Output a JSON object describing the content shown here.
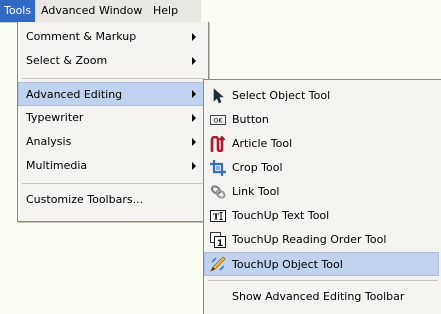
{
  "menubar": {
    "items": [
      {
        "label": "Tools",
        "active": true
      },
      {
        "label": "Advanced"
      },
      {
        "label": "Window"
      },
      {
        "label": "Help"
      }
    ]
  },
  "tools_menu": {
    "items": [
      {
        "label": "Comment & Markup",
        "has_submenu": true
      },
      {
        "label": "Select & Zoom",
        "has_submenu": true
      },
      {
        "label": "Advanced Editing",
        "has_submenu": true,
        "highlighted": true
      },
      {
        "label": "Typewriter",
        "has_submenu": true
      },
      {
        "label": "Analysis",
        "has_submenu": true
      },
      {
        "label": "Multimedia",
        "has_submenu": true
      },
      {
        "label": "Customize Toolbars..."
      }
    ]
  },
  "advanced_editing_menu": {
    "items": [
      {
        "label": "Select Object Tool",
        "icon": "select-object-arrow-icon"
      },
      {
        "label": "Button",
        "icon": "ok-button-icon"
      },
      {
        "label": "Article Tool",
        "icon": "article-icon"
      },
      {
        "label": "Crop Tool",
        "icon": "crop-icon"
      },
      {
        "label": "Link Tool",
        "icon": "link-icon"
      },
      {
        "label": "TouchUp Text Tool",
        "icon": "touchup-text-icon"
      },
      {
        "label": "TouchUp Reading Order Tool",
        "icon": "reading-order-icon"
      },
      {
        "label": "TouchUp Object Tool",
        "icon": "touchup-object-icon",
        "highlighted": true
      },
      {
        "label": "Show Advanced Editing Toolbar"
      }
    ]
  },
  "colors": {
    "menubar_active": "#316ac5",
    "highlight": "#c1d2ee",
    "menu_bg": "#f4f3ef"
  }
}
